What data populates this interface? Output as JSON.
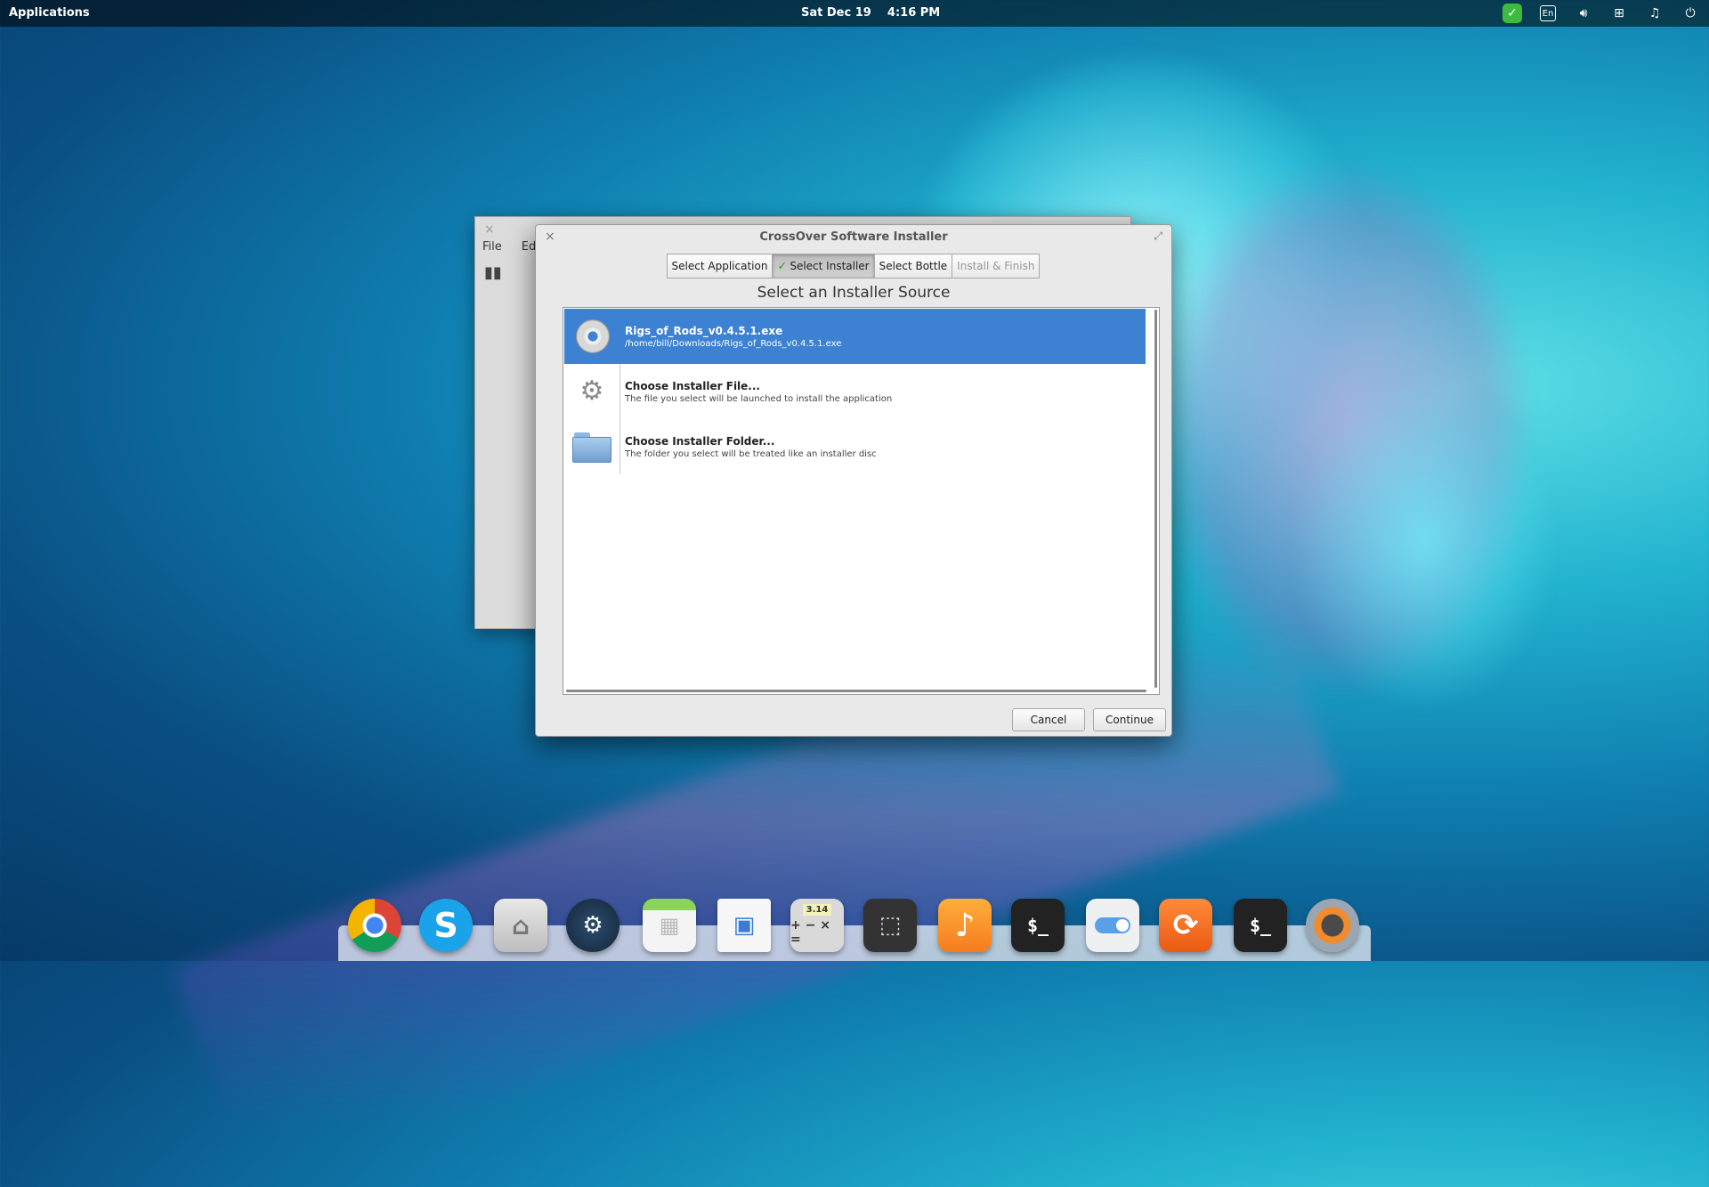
{
  "panel": {
    "applications": "Applications",
    "date": "Sat Dec 19",
    "time": "4:16 PM",
    "keyboard_layout": "En",
    "tray_icons": [
      "check-icon",
      "keyboard-layout-icon",
      "volume-icon",
      "network-icon",
      "notifications-icon",
      "power-icon"
    ]
  },
  "background_window": {
    "menu": [
      "File",
      "Edit"
    ]
  },
  "dialog": {
    "title": "CrossOver Software Installer",
    "steps": [
      {
        "label": "Select Application",
        "state": "normal"
      },
      {
        "label": "Select Installer",
        "state": "active"
      },
      {
        "label": "Select Bottle",
        "state": "normal"
      },
      {
        "label": "Install & Finish",
        "state": "disabled"
      }
    ],
    "heading": "Select an Installer Source",
    "items": [
      {
        "title": "Rigs_of_Rods_v0.4.5.1.exe",
        "subtitle": "/home/bill/Downloads/Rigs_of_Rods_v0.4.5.1.exe",
        "icon": "disc-icon",
        "selected": true
      },
      {
        "title": "Choose Installer File...",
        "subtitle": "The file you select will be launched to install the application",
        "icon": "gears-icon",
        "selected": false
      },
      {
        "title": "Choose Installer Folder...",
        "subtitle": "The folder you select will be treated like an installer disc",
        "icon": "folder-icon",
        "selected": false
      }
    ],
    "cancel_label": "Cancel",
    "continue_label": "Continue"
  },
  "dock": {
    "items": [
      "chrome-icon",
      "skype-icon",
      "files-icon",
      "steam-icon",
      "calendar-icon",
      "image-viewer-icon",
      "calculator-icon",
      "screenshot-icon",
      "music-icon",
      "terminal-icon",
      "switchboard-icon",
      "update-icon",
      "terminal-icon",
      "crossover-icon"
    ],
    "calculator_display": "3.14"
  },
  "colors": {
    "selection": "#3d82d2",
    "panel": "#000000"
  }
}
